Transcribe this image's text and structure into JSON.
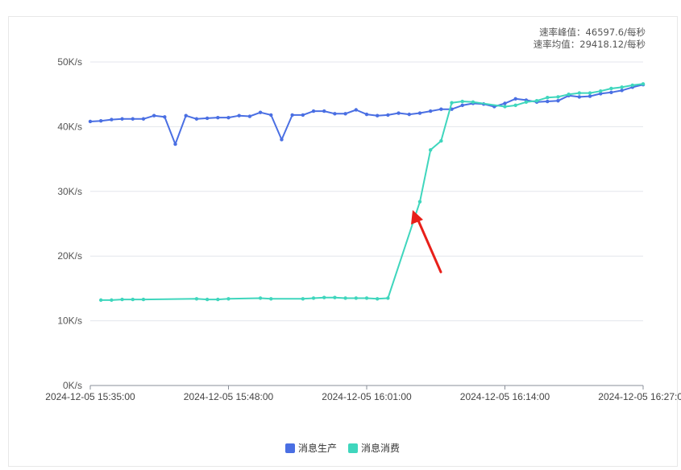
{
  "stats": {
    "peak_label": "速率峰值：46597.6/每秒",
    "avg_label": "速率均值：29418.12/每秒"
  },
  "chart_data": {
    "type": "line",
    "y_ticks": [
      "0K/s",
      "10K/s",
      "20K/s",
      "30K/s",
      "40K/s",
      "50K/s"
    ],
    "ylim": [
      0,
      50
    ],
    "x_tick_labels": [
      "2024-12-05 15:35:00",
      "2024-12-05 15:48:00",
      "2024-12-05 16:01:00",
      "2024-12-05 16:14:00",
      "2024-12-05 16:27:00"
    ],
    "x_tick_minutes": [
      0,
      13,
      26,
      39,
      52
    ],
    "xlim_minutes": [
      0,
      52
    ],
    "series": [
      {
        "name": "消息生产",
        "color": "#4a6fe3",
        "x": [
          0,
          1,
          2,
          3,
          4,
          5,
          6,
          7,
          8,
          9,
          10,
          11,
          12,
          13,
          14,
          15,
          16,
          17,
          18,
          19,
          20,
          21,
          22,
          23,
          24,
          25,
          26,
          27,
          28,
          29,
          30,
          31,
          32,
          33,
          34,
          35,
          36,
          37,
          38,
          39,
          40,
          41,
          42,
          43,
          44,
          45,
          46,
          47,
          48,
          49,
          50,
          51,
          52
        ],
        "values": [
          40.8,
          40.9,
          41.1,
          41.2,
          41.2,
          41.2,
          41.7,
          41.5,
          37.3,
          41.7,
          41.2,
          41.3,
          41.4,
          41.4,
          41.7,
          41.6,
          42.2,
          41.8,
          38.0,
          41.8,
          41.8,
          42.4,
          42.4,
          42.0,
          42.0,
          42.6,
          41.9,
          41.7,
          41.8,
          42.1,
          41.9,
          42.1,
          42.4,
          42.7,
          42.7,
          43.3,
          43.6,
          43.5,
          43.1,
          43.6,
          44.3,
          44.1,
          43.8,
          43.9,
          44.0,
          44.8,
          44.6,
          44.7,
          45.1,
          45.3,
          45.6,
          46.1,
          46.5
        ]
      },
      {
        "name": "消息消费",
        "color": "#3fd6bd",
        "x": [
          1,
          2,
          3,
          4,
          5,
          10,
          11,
          12,
          13,
          16,
          17,
          20,
          21,
          22,
          23,
          24,
          25,
          26,
          27,
          28,
          31,
          32,
          33,
          34,
          35,
          36,
          39,
          40,
          41,
          42,
          43,
          44,
          45,
          46,
          47,
          48,
          49,
          50,
          51,
          52
        ],
        "values": [
          13.2,
          13.2,
          13.3,
          13.3,
          13.3,
          13.4,
          13.3,
          13.3,
          13.4,
          13.5,
          13.4,
          13.4,
          13.5,
          13.6,
          13.6,
          13.5,
          13.5,
          13.5,
          13.4,
          13.5,
          28.4,
          36.4,
          37.8,
          43.7,
          43.9,
          43.8,
          43.1,
          43.3,
          43.8,
          44.0,
          44.5,
          44.6,
          45.0,
          45.2,
          45.2,
          45.5,
          45.9,
          46.1,
          46.4,
          46.6
        ]
      }
    ],
    "grid": true,
    "legend_position": "bottom-center"
  },
  "annotation": {
    "type": "arrow",
    "color": "#e8201a"
  }
}
